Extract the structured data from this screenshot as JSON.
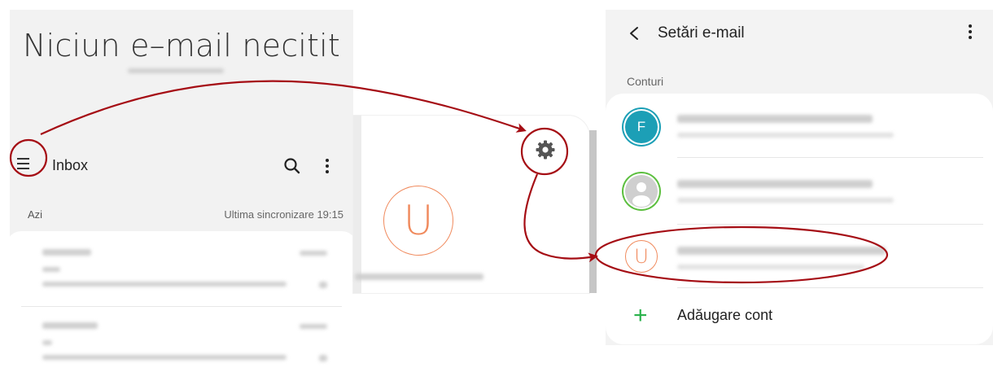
{
  "inbox": {
    "header_title": "Niciun e–mail necitit",
    "folder_label": "Inbox",
    "date_label": "Azi",
    "sync_status": "Ultima sincronizare 19:15",
    "icons": [
      "menu-icon",
      "search-icon",
      "more-vert-icon"
    ]
  },
  "drawer": {
    "avatar_letter": "U",
    "icons": [
      "gear-icon"
    ]
  },
  "settings": {
    "title": "Setări e-mail",
    "section_label": "Conturi",
    "accounts": [
      {
        "avatar_letter": "F",
        "avatar_color": "#1c9fb6"
      },
      {
        "avatar_letter": "",
        "avatar_color": "#5cbf3f"
      },
      {
        "avatar_letter": "U",
        "avatar_color": "#f08a5d"
      }
    ],
    "add_account_label": "Adăugare cont",
    "icons": [
      "back-icon",
      "more-vert-icon",
      "plus-icon"
    ]
  },
  "colors": {
    "annotation": "#a50d14",
    "accent_orange": "#f08a5d",
    "add_green": "#2bb24c"
  }
}
